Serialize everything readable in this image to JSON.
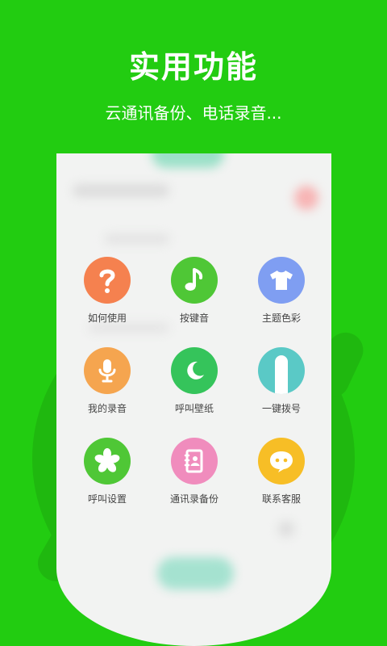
{
  "header": {
    "title": "实用功能",
    "subtitle": "云通讯备份、电话录音..."
  },
  "colors": {
    "background": "#22cc11",
    "how_to_use": "#f5814f",
    "key_sound": "#4fc736",
    "theme_color": "#7f9ef2",
    "my_recording": "#f5a54f",
    "call_wallpaper": "#35c45b",
    "one_key_dial": "#5ac9c6",
    "call_settings": "#4fc736",
    "contacts_backup": "#f08cbd",
    "contact_service": "#f7be26"
  },
  "features": [
    {
      "label": "如何使用",
      "icon": "question-icon"
    },
    {
      "label": "按键音",
      "icon": "music-note-icon"
    },
    {
      "label": "主题色彩",
      "icon": "tshirt-icon"
    },
    {
      "label": "我的录音",
      "icon": "microphone-icon"
    },
    {
      "label": "呼叫壁纸",
      "icon": "crescent-moon-icon"
    },
    {
      "label": "一键拨号",
      "icon": "finger-icon"
    },
    {
      "label": "呼叫设置",
      "icon": "asterisk-icon"
    },
    {
      "label": "通讯录备份",
      "icon": "contacts-book-icon"
    },
    {
      "label": "联系客服",
      "icon": "chat-bubble-icon"
    }
  ]
}
